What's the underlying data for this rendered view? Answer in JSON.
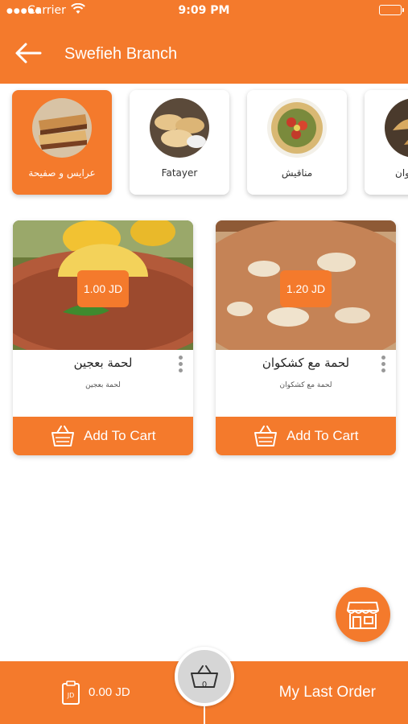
{
  "status_bar": {
    "carrier": "Carrier",
    "time": "9:09 PM"
  },
  "header": {
    "title": "Swefieh Branch"
  },
  "categories": [
    {
      "label": "عرايس و صفيحة",
      "active": true
    },
    {
      "label": "Fatayer",
      "active": false
    },
    {
      "label": "مناقيش",
      "active": false
    },
    {
      "label": "وان",
      "active": false
    }
  ],
  "products": [
    {
      "name": "لحمة بعجين",
      "description": "لحمة بعجين",
      "price": "1.00 JD",
      "cta": "Add To Cart"
    },
    {
      "name": "لحمة مع كشكوان",
      "description": "لحمة مع كشكوان",
      "price": "1.20 JD",
      "cta": "Add To Cart"
    }
  ],
  "bottom_bar": {
    "wallet_amount": "0.00 JD",
    "wallet_icon_text": "JD",
    "basket_count": "0",
    "last_order_label": "My Last Order"
  },
  "colors": {
    "primary": "#f47a2c",
    "basket_bg": "#d6d6d6"
  },
  "icons": [
    "back-arrow-icon",
    "wifi-icon",
    "battery-icon",
    "more-vertical-icon",
    "cart-icon",
    "store-icon",
    "basket-icon",
    "wallet-icon"
  ]
}
